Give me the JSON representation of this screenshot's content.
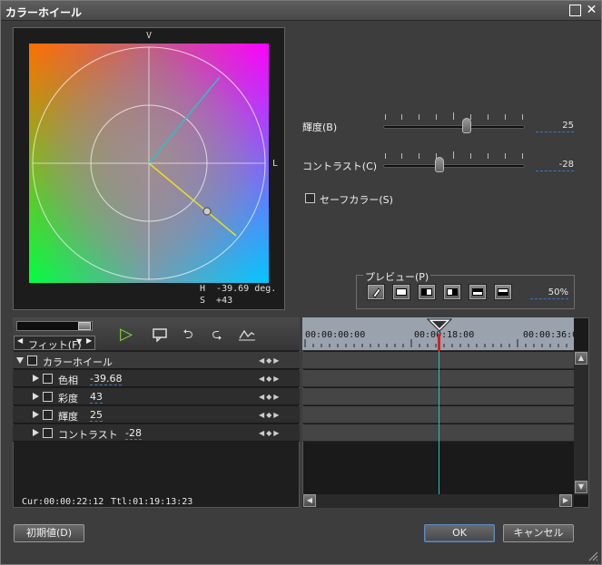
{
  "window": {
    "title": "カラーホイール",
    "maximize_icon": "maximize-icon",
    "close_icon": "close-icon"
  },
  "wheel": {
    "top_label": "V",
    "right_label": "L",
    "readout_h": "H  -39.69 deg.",
    "readout_s": "S  +43"
  },
  "sliders": {
    "brightness": {
      "label": "輝度(B)",
      "value": "25"
    },
    "contrast": {
      "label": "コントラスト(C)",
      "value": "-28"
    }
  },
  "safe_color": {
    "label": "セーフカラー(S)",
    "checked": false
  },
  "preview": {
    "legend": "プレビュー(P)",
    "zoom": "50%",
    "buttons": [
      "eraser-icon",
      "full-view-icon",
      "split-left-icon",
      "split-right-icon",
      "split-top-icon",
      "split-bottom-icon"
    ]
  },
  "toolbar": {
    "fit_label": "フィット(F)",
    "icons": [
      "play-icon",
      "comment-icon",
      "undo-icon",
      "redo-icon",
      "graph-icon"
    ]
  },
  "tracks": {
    "parent": {
      "label": "カラーホイール"
    },
    "items": [
      {
        "label": "色相",
        "value": "-39.68"
      },
      {
        "label": "彩度",
        "value": "43"
      },
      {
        "label": "輝度",
        "value": "25"
      },
      {
        "label": "コントラスト",
        "value": "-28"
      }
    ]
  },
  "timeline": {
    "ruler": [
      "00:00:00:00",
      "00:00:18:00",
      "00:00:36:00"
    ]
  },
  "status": {
    "cur": "Cur:00:00:22:12",
    "ttl": "Ttl:01:19:13:23"
  },
  "buttons": {
    "reset": "初期値(D)",
    "ok": "OK",
    "cancel": "キャンセル"
  }
}
